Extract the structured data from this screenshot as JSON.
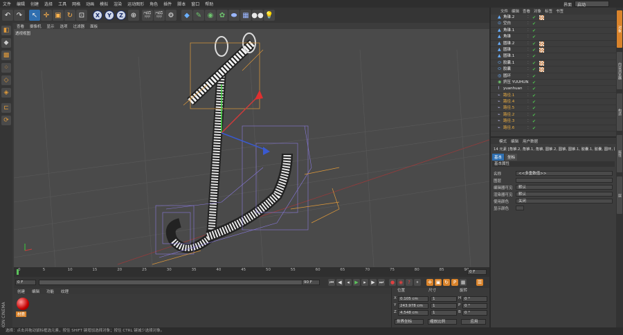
{
  "menubar": {
    "items": [
      "文件",
      "编辑",
      "创建",
      "选择",
      "工具",
      "网格",
      "动画",
      "模拟",
      "渲染",
      "运动图形",
      "角色",
      "插件",
      "脚本",
      "窗口",
      "帮助"
    ],
    "layout_label": "界面",
    "layout_value": "启动"
  },
  "viewport": {
    "menu": [
      "查看",
      "摄像机",
      "显示",
      "选项",
      "过滤器",
      "面板"
    ],
    "label": "透视视图"
  },
  "timeline": {
    "ticks": [
      "0",
      "5",
      "10",
      "15",
      "20",
      "25",
      "30",
      "35",
      "40",
      "45",
      "50",
      "55",
      "60",
      "65",
      "70",
      "75",
      "80",
      "85",
      "90"
    ],
    "end_field": "0 F"
  },
  "playback": {
    "current_frame": "0 F",
    "end_frame": "90 F",
    "range_end": "90 F"
  },
  "material_panel": {
    "menu": [
      "创建",
      "编辑",
      "功能",
      "纹理"
    ],
    "material_name": "材质"
  },
  "coords": {
    "headers": [
      "位置",
      "尺寸",
      "旋转"
    ],
    "rows": [
      {
        "axis": "X",
        "pos": "0.105 cm",
        "size": "1",
        "rot_label": "H",
        "rot": "0 °"
      },
      {
        "axis": "Y",
        "pos": "243.978 cm",
        "size": "1",
        "rot_label": "P",
        "rot": "0 °"
      },
      {
        "axis": "Z",
        "pos": "4.548 cm",
        "size": "1",
        "rot_label": "B",
        "rot": "0 °"
      }
    ],
    "mode": "世界坐标",
    "scale_mode": "缩放比例",
    "apply": "应用"
  },
  "status": {
    "text": "选择：点击并拖动鼠标框选元素，按住 SHIFT 键增加选择对象；按住 CTRL 键减少选择对象。"
  },
  "objects": {
    "menu": [
      "文件",
      "编辑",
      "查看",
      "对象",
      "标签",
      "书签"
    ],
    "rows": [
      {
        "name": "角锥.2",
        "icon": "pyramid",
        "tag": true
      },
      {
        "name": "空白",
        "icon": "null",
        "tag": false
      },
      {
        "name": "角锥.1",
        "icon": "pyramid",
        "tag": false
      },
      {
        "name": "角锥",
        "icon": "pyramid",
        "tag": false
      },
      {
        "name": "圆锥.2",
        "icon": "cone",
        "tag": true
      },
      {
        "name": "圆锥",
        "icon": "cone",
        "tag": true
      },
      {
        "name": "圆锥.1",
        "icon": "cone",
        "tag": false
      },
      {
        "name": "胶囊.1",
        "icon": "capsule",
        "tag": true
      },
      {
        "name": "胶囊",
        "icon": "capsule",
        "tag": true
      },
      {
        "name": "圆环",
        "icon": "torus",
        "tag": false
      },
      {
        "name": "挤压 YUUHUN",
        "icon": "extrude",
        "tag": false
      },
      {
        "name": "yuanhuan",
        "icon": "spline",
        "tag": false
      },
      {
        "name": "路径.1",
        "icon": "path",
        "tag": false
      },
      {
        "name": "路径.4",
        "icon": "path",
        "tag": false
      },
      {
        "name": "路径.5",
        "icon": "path",
        "tag": false
      },
      {
        "name": "路径.2",
        "icon": "path",
        "tag": false
      },
      {
        "name": "路径.3",
        "icon": "path",
        "tag": false
      },
      {
        "name": "路径.6",
        "icon": "path",
        "tag": false
      }
    ]
  },
  "attributes": {
    "menu": [
      "模式",
      "编辑",
      "用户数据"
    ],
    "summary": "14 元素 [角锥.2, 角锥.1, 角锥, 圆锥.2, 圆锥, 圆锥.1, 胶囊.1, 胶囊, 圆环, 挤压 Y, 路径.1, 路径.4...]",
    "tabs": [
      "基本",
      "坐标"
    ],
    "section": "基本属性",
    "fields": [
      {
        "label": "名称",
        "value": "<<多重数值>>"
      },
      {
        "label": "图层",
        "value": ""
      },
      {
        "label": "编辑器可见",
        "value": "默认"
      },
      {
        "label": "渲染器可见",
        "value": "默认"
      },
      {
        "label": "使用颜色",
        "value": "关闭"
      },
      {
        "label": "显示颜色",
        "value": ""
      }
    ]
  },
  "right_strip": {
    "tabs": [
      "对象",
      "内容浏览器",
      "构造",
      "属性",
      "层"
    ]
  },
  "colors": {
    "accent": "#2f6fb0",
    "orange": "#e09a3a",
    "check": "#4fc24f"
  }
}
